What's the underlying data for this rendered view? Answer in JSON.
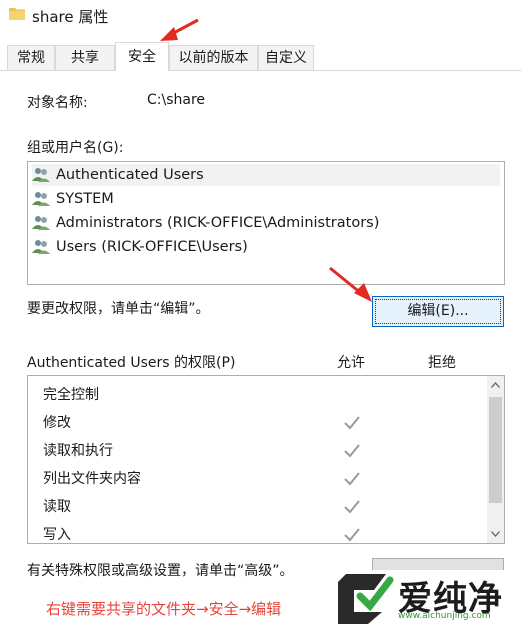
{
  "window": {
    "title": "share 属性"
  },
  "tabs": [
    {
      "label": "常规",
      "active": false
    },
    {
      "label": "共享",
      "active": false
    },
    {
      "label": "安全",
      "active": true
    },
    {
      "label": "以前的版本",
      "active": false
    },
    {
      "label": "自定义",
      "active": false
    }
  ],
  "object": {
    "label": "对象名称:",
    "value": "C:\\share"
  },
  "groups": {
    "label": "组或用户名(G):",
    "items": [
      "Authenticated Users",
      "SYSTEM",
      "Administrators (RICK-OFFICE\\Administrators)",
      "Users (RICK-OFFICE\\Users)"
    ],
    "selected_index": 0
  },
  "change_hint": "要更改权限，请单击“编辑”。",
  "edit_button": {
    "label": "编辑(E)..."
  },
  "permissions": {
    "header": "Authenticated Users 的权限(P)",
    "allow_label": "允许",
    "deny_label": "拒绝",
    "rows": [
      {
        "name": "完全控制",
        "allow": false
      },
      {
        "name": "修改",
        "allow": true
      },
      {
        "name": "读取和执行",
        "allow": true
      },
      {
        "name": "列出文件夹内容",
        "allow": true
      },
      {
        "name": "读取",
        "allow": true
      },
      {
        "name": "写入",
        "allow": true
      }
    ]
  },
  "advanced_hint": "有关特殊权限或高级设置，请单击“高级”。",
  "caption": "右键需要共享的文件夹→安全→编辑",
  "watermark": {
    "brand": "爱纯净",
    "url": "www.aichunjing.com"
  },
  "colors": {
    "accent_button_border": "#0a64c8",
    "caption_red": "#e8453c",
    "watermark_green": "#2c9b3a"
  }
}
